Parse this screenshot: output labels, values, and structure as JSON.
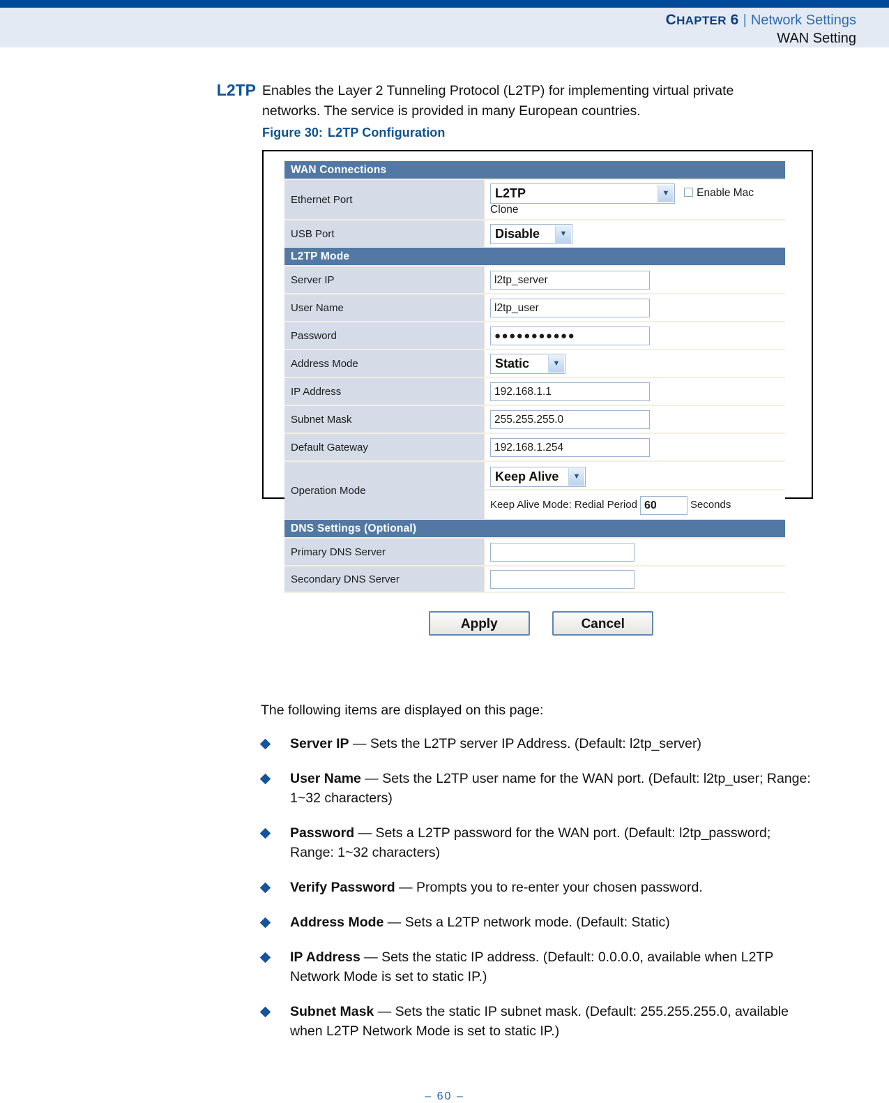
{
  "header": {
    "chapter_label_caps": "C",
    "chapter_label_rest": "HAPTER",
    "chapter_number": "6",
    "separator": "|",
    "section": "Network Settings",
    "subsection": "WAN Setting"
  },
  "intro": {
    "term": "L2TP",
    "text": "Enables the Layer 2 Tunneling Protocol (L2TP) for implementing virtual private networks. The service is provided in many European countries."
  },
  "figure": {
    "caption_number": "Figure 30:",
    "caption_title": "L2TP Configuration"
  },
  "ui": {
    "sections": {
      "wan_connections": "WAN Connections",
      "l2tp_mode": "L2TP Mode",
      "dns_settings": "DNS Settings (Optional)"
    },
    "rows": {
      "ethernet_port": {
        "label": "Ethernet Port",
        "select_value": "L2TP",
        "checkbox_label_line1": "Enable Mac",
        "checkbox_label_line2": "Clone",
        "checkbox_checked": false
      },
      "usb_port": {
        "label": "USB Port",
        "select_value": "Disable"
      },
      "server_ip": {
        "label": "Server IP",
        "value": "l2tp_server"
      },
      "user_name": {
        "label": "User Name",
        "value": "l2tp_user"
      },
      "password": {
        "label": "Password",
        "value": "●●●●●●●●●●●"
      },
      "address_mode": {
        "label": "Address Mode",
        "select_value": "Static"
      },
      "ip_address": {
        "label": "IP Address",
        "value": "192.168.1.1"
      },
      "subnet_mask": {
        "label": "Subnet Mask",
        "value": "255.255.255.0"
      },
      "default_gateway": {
        "label": "Default Gateway",
        "value": "192.168.1.254"
      },
      "operation_mode": {
        "label": "Operation Mode",
        "select_value": "Keep Alive",
        "keepalive_prefix": "Keep Alive Mode: Redial Period",
        "keepalive_value": "60",
        "keepalive_suffix": "Seconds"
      },
      "primary_dns": {
        "label": "Primary DNS Server",
        "value": ""
      },
      "secondary_dns": {
        "label": "Secondary DNS Server",
        "value": ""
      }
    },
    "buttons": {
      "apply": "Apply",
      "cancel": "Cancel"
    },
    "dropdown_arrow_glyph": "▼"
  },
  "list_intro": "The following items are displayed on this page:",
  "bullets": [
    {
      "term": "Server IP",
      "desc": " — Sets the L2TP server IP Address. (Default: l2tp_server)"
    },
    {
      "term": "User Name",
      "desc": " — Sets the L2TP user name for the WAN port. (Default: l2tp_user; Range: 1~32 characters)"
    },
    {
      "term": "Password",
      "desc": " — Sets a L2TP password for the WAN port. (Default: l2tp_password; Range: 1~32 characters)"
    },
    {
      "term": "Verify Password",
      "desc": " — Prompts you to re-enter your chosen password."
    },
    {
      "term": "Address Mode",
      "desc": " — Sets a L2TP network mode. (Default: Static)"
    },
    {
      "term": "IP Address",
      "desc": " — Sets the static IP address. (Default: 0.0.0.0, available when L2TP Network Mode is set to static IP.)"
    },
    {
      "term": "Subnet Mask",
      "desc": " — Sets the static IP subnet mask. (Default: 255.255.255.0, available when L2TP Network Mode is set to static IP.)"
    }
  ],
  "footer": {
    "page": "–  60  –"
  },
  "colors": {
    "top_rule": "#004a99",
    "header_band": "#e4eaf3",
    "accent_blue": "#0b5394",
    "section_header": "#5278a3",
    "label_cell": "#d5dce8",
    "bullet": "#15549b"
  }
}
